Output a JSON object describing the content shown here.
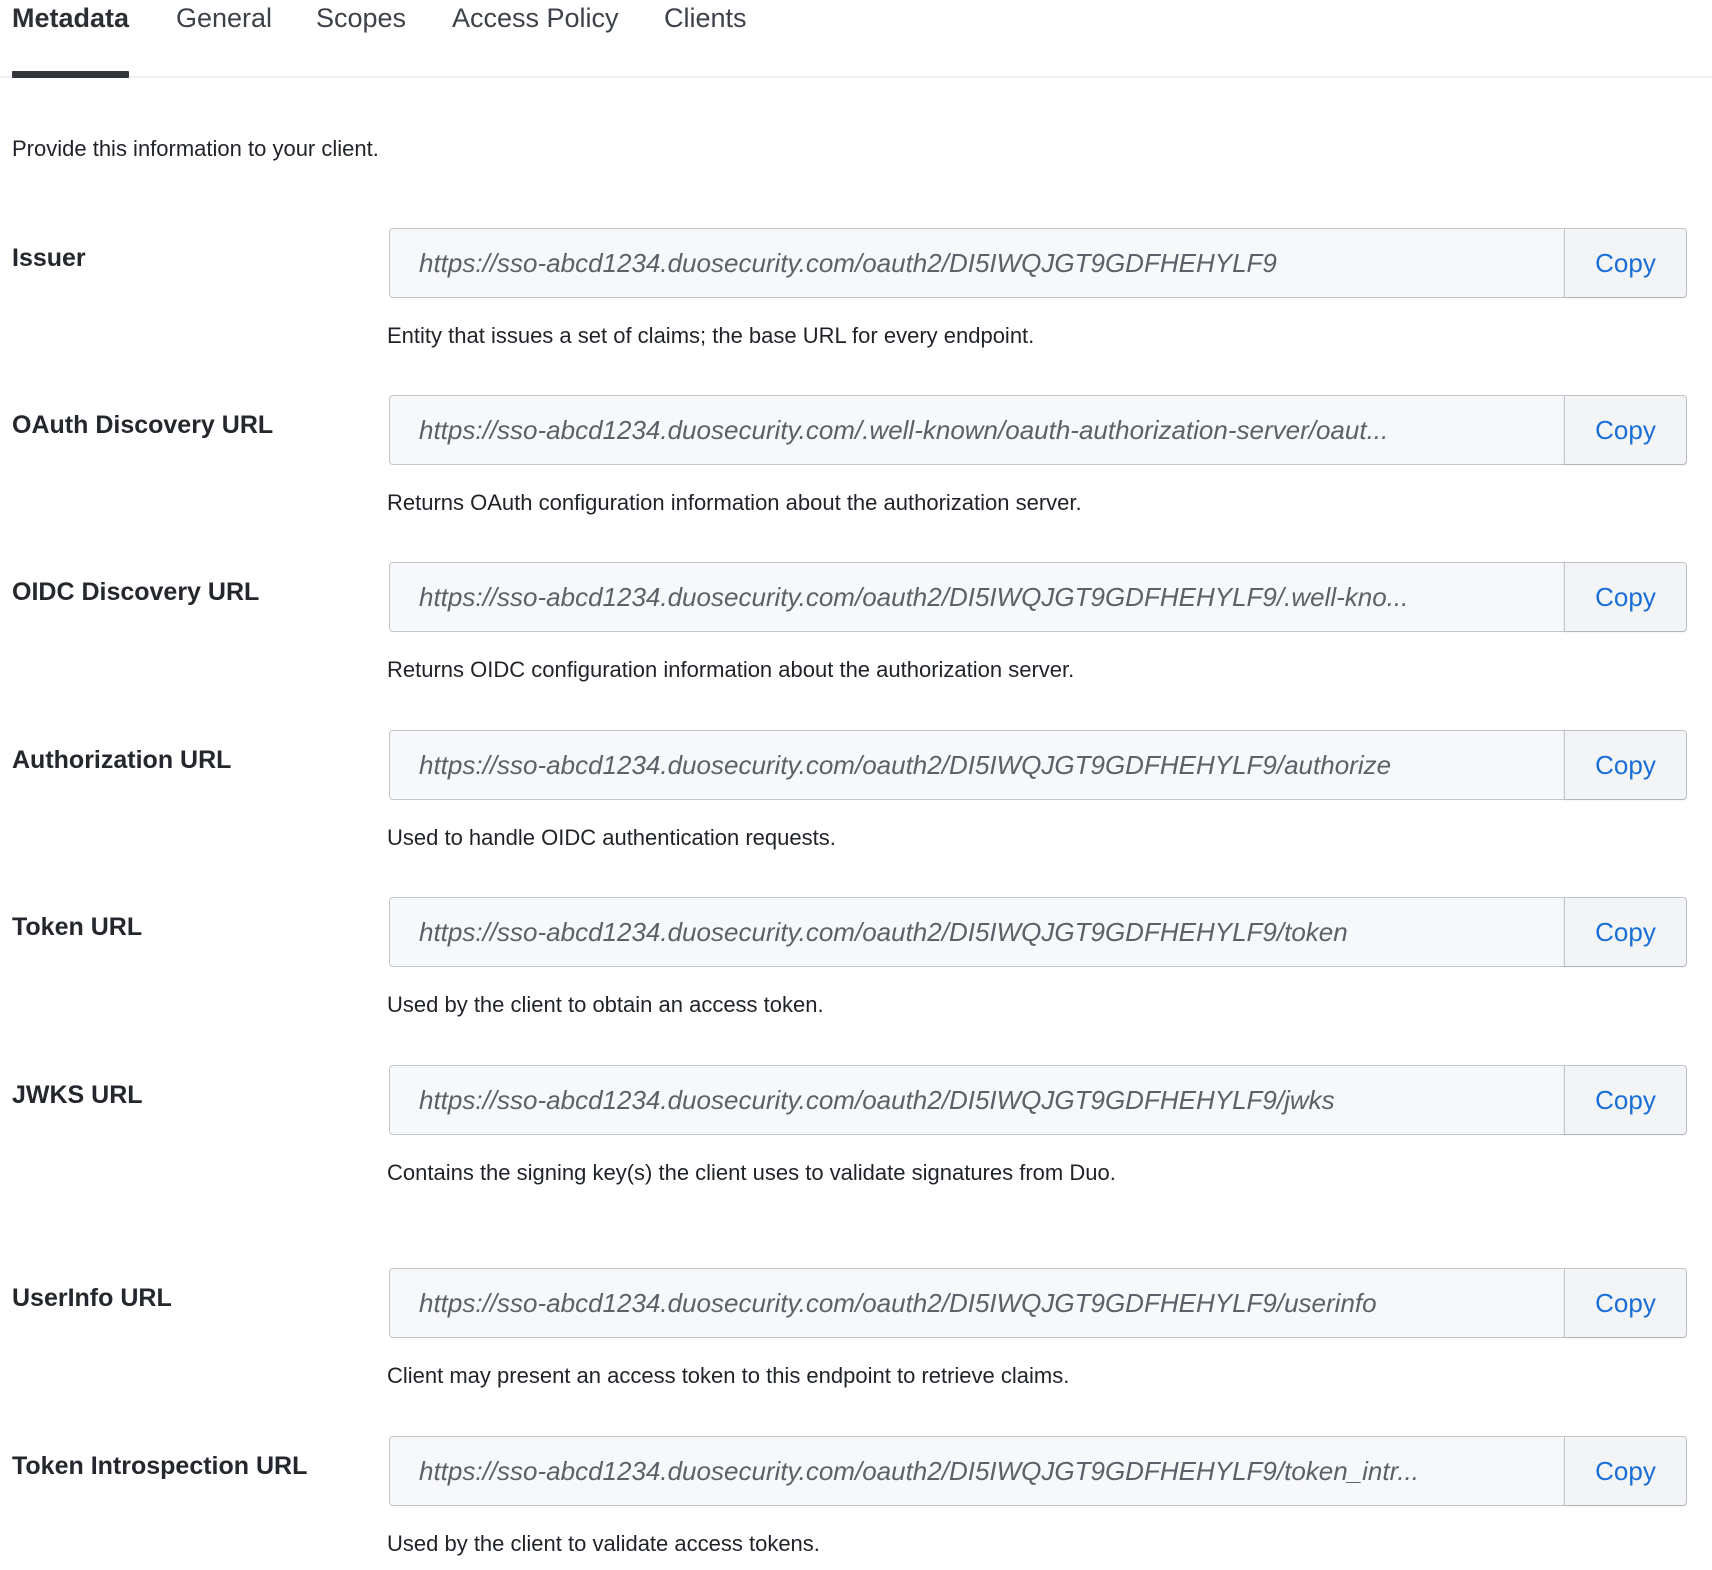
{
  "tabs": [
    {
      "label": "Metadata"
    },
    {
      "label": "General"
    },
    {
      "label": "Scopes"
    },
    {
      "label": "Access Policy"
    },
    {
      "label": "Clients"
    }
  ],
  "intro": "Provide this information to your client.",
  "copy_label": "Copy",
  "fields": [
    {
      "label": "Issuer",
      "value": "https://sso-abcd1234.duosecurity.com/oauth2/DI5IWQJGT9GDFHEHYLF9",
      "description": "Entity that issues a set of claims; the base URL for every endpoint."
    },
    {
      "label": "OAuth Discovery URL",
      "value": "https://sso-abcd1234.duosecurity.com/.well-known/oauth-authorization-server/oaut...",
      "description": "Returns OAuth configuration information about the authorization server."
    },
    {
      "label": "OIDC Discovery URL",
      "value": "https://sso-abcd1234.duosecurity.com/oauth2/DI5IWQJGT9GDFHEHYLF9/.well-kno...",
      "description": "Returns OIDC configuration information about the authorization server."
    },
    {
      "label": "Authorization URL",
      "value": "https://sso-abcd1234.duosecurity.com/oauth2/DI5IWQJGT9GDFHEHYLF9/authorize",
      "description": "Used to handle OIDC authentication requests."
    },
    {
      "label": "Token URL",
      "value": "https://sso-abcd1234.duosecurity.com/oauth2/DI5IWQJGT9GDFHEHYLF9/token",
      "description": "Used by the client to obtain an access token."
    },
    {
      "label": "JWKS URL",
      "value": "https://sso-abcd1234.duosecurity.com/oauth2/DI5IWQJGT9GDFHEHYLF9/jwks",
      "description": "Contains the signing key(s) the client uses to validate signatures from Duo."
    },
    {
      "label": "UserInfo URL",
      "value": "https://sso-abcd1234.duosecurity.com/oauth2/DI5IWQJGT9GDFHEHYLF9/userinfo",
      "description": "Client may present an access token to this endpoint to retrieve claims."
    },
    {
      "label": "Token Introspection URL",
      "value": "https://sso-abcd1234.duosecurity.com/oauth2/DI5IWQJGT9GDFHEHYLF9/token_intr...",
      "description": "Used by the client to validate access tokens."
    }
  ]
}
